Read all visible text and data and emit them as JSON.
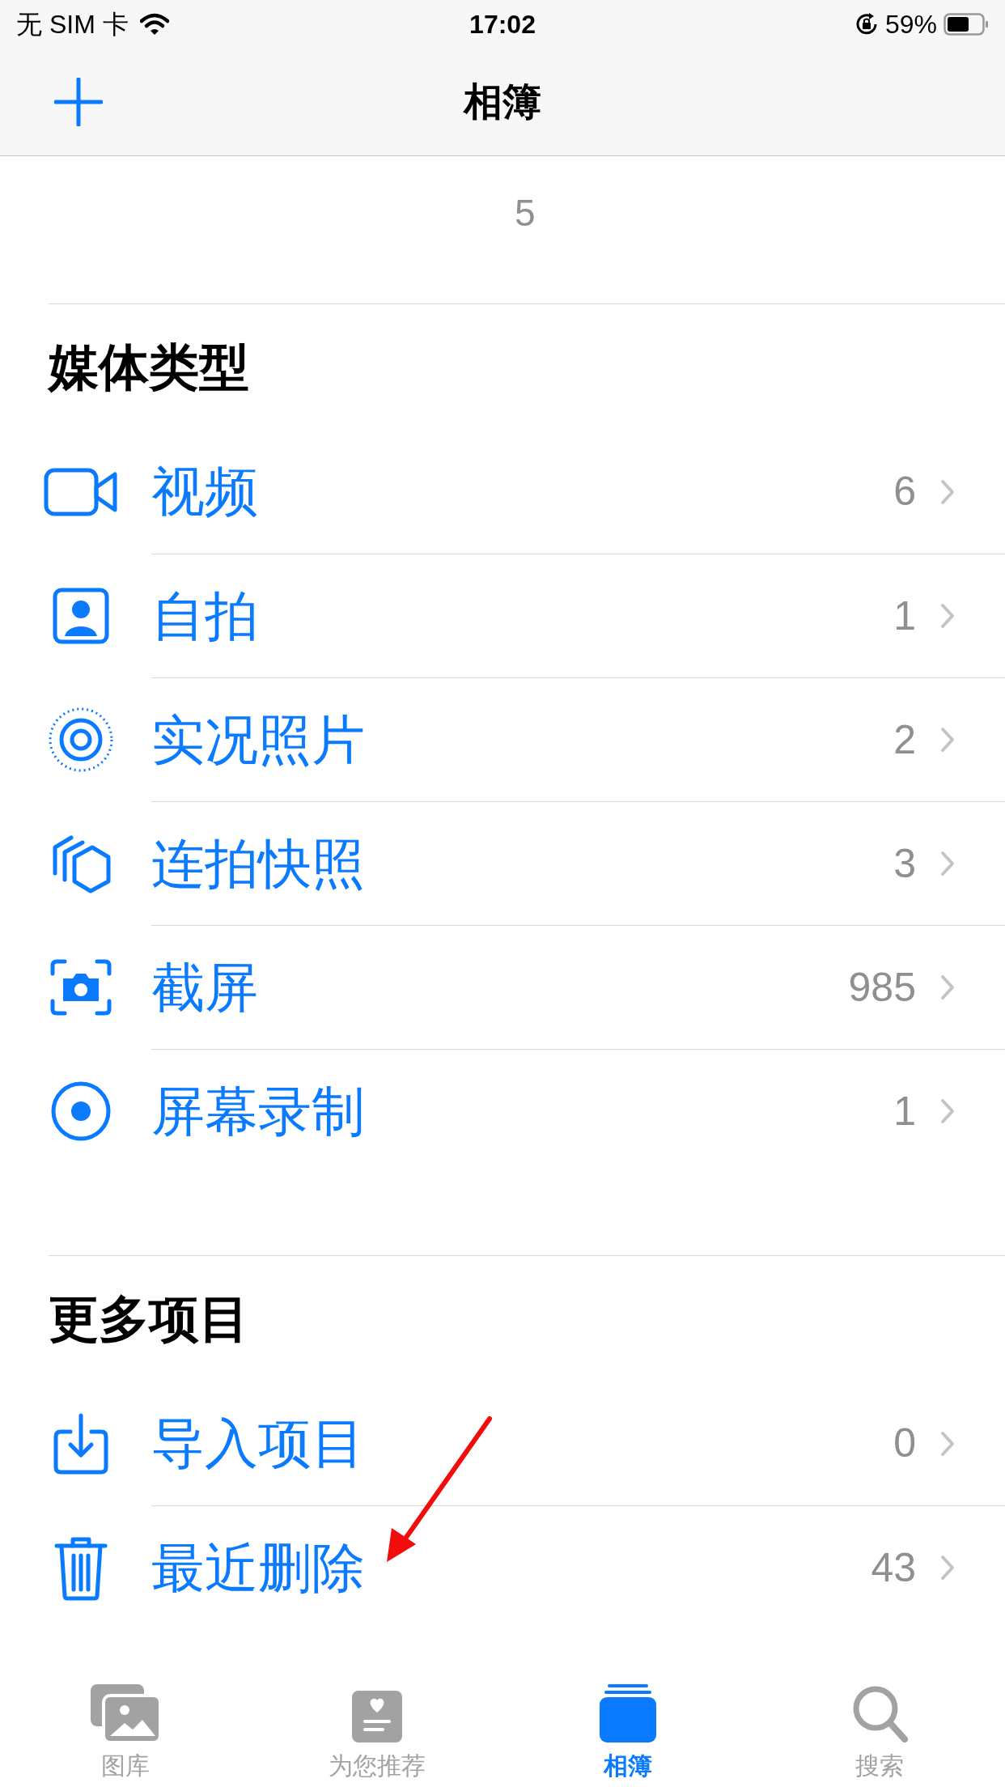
{
  "status_bar": {
    "carrier": "无 SIM 卡",
    "time": "17:02",
    "battery": "59%"
  },
  "nav": {
    "title": "相簿"
  },
  "places": {
    "count": "5"
  },
  "sections": [
    {
      "title": "媒体类型",
      "rows": [
        {
          "kind": "video",
          "label": "视频",
          "count": "6"
        },
        {
          "kind": "selfie",
          "label": "自拍",
          "count": "1"
        },
        {
          "kind": "live",
          "label": "实况照片",
          "count": "2"
        },
        {
          "kind": "burst",
          "label": "连拍快照",
          "count": "3"
        },
        {
          "kind": "screenshot",
          "label": "截屏",
          "count": "985"
        },
        {
          "kind": "recording",
          "label": "屏幕录制",
          "count": "1"
        }
      ]
    },
    {
      "title": "更多项目",
      "rows": [
        {
          "kind": "import",
          "label": "导入项目",
          "count": "0"
        },
        {
          "kind": "trash",
          "label": "最近删除",
          "count": "43"
        }
      ]
    }
  ],
  "tabs": [
    {
      "kind": "library",
      "label": "图库",
      "selected": false
    },
    {
      "kind": "foryou",
      "label": "为您推荐",
      "selected": false
    },
    {
      "kind": "albums",
      "label": "相簿",
      "selected": true
    },
    {
      "kind": "search",
      "label": "搜索",
      "selected": false
    }
  ]
}
